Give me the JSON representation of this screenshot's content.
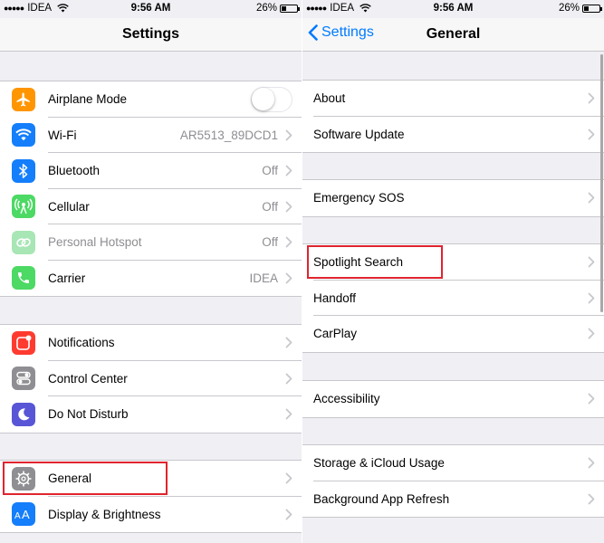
{
  "status": {
    "carrier": "IDEA",
    "time": "9:56 AM",
    "battery": "26%"
  },
  "left": {
    "title": "Settings",
    "groups": [
      [
        {
          "label": "Airplane Mode",
          "icon": "airplane-icon",
          "color": "#ff9500",
          "toggle": "off"
        },
        {
          "label": "Wi-Fi",
          "value": "AR5513_89DCD1",
          "icon": "wifi-icon",
          "color": "#147efb"
        },
        {
          "label": "Bluetooth",
          "value": "Off",
          "icon": "bluetooth-icon",
          "color": "#147efb"
        },
        {
          "label": "Cellular",
          "value": "Off",
          "icon": "cellular-icon",
          "color": "#4cd964"
        },
        {
          "label": "Personal Hotspot",
          "value": "Off",
          "icon": "hotspot-icon",
          "color": "#a8e6b5",
          "dimmed": true
        },
        {
          "label": "Carrier",
          "value": "IDEA",
          "icon": "phone-icon",
          "color": "#4cd964"
        }
      ],
      [
        {
          "label": "Notifications",
          "icon": "notifications-icon",
          "color": "#ff3b30"
        },
        {
          "label": "Control Center",
          "icon": "control-center-icon",
          "color": "#8e8e93"
        },
        {
          "label": "Do Not Disturb",
          "icon": "moon-icon",
          "color": "#5856d6"
        }
      ],
      [
        {
          "label": "General",
          "icon": "gear-icon",
          "color": "#8e8e93",
          "highlighted": true
        },
        {
          "label": "Display & Brightness",
          "icon": "display-icon",
          "color": "#147efb"
        }
      ]
    ]
  },
  "right": {
    "back_label": "Settings",
    "title": "General",
    "groups": [
      [
        {
          "label": "About"
        },
        {
          "label": "Software Update"
        }
      ],
      [
        {
          "label": "Emergency SOS"
        }
      ],
      [
        {
          "label": "Spotlight Search",
          "highlighted": true
        },
        {
          "label": "Handoff"
        },
        {
          "label": "CarPlay"
        }
      ],
      [
        {
          "label": "Accessibility"
        }
      ],
      [
        {
          "label": "Storage & iCloud Usage"
        },
        {
          "label": "Background App Refresh"
        }
      ]
    ]
  },
  "colors": {
    "accent": "#007aff",
    "highlight_box": "#e0242e"
  }
}
